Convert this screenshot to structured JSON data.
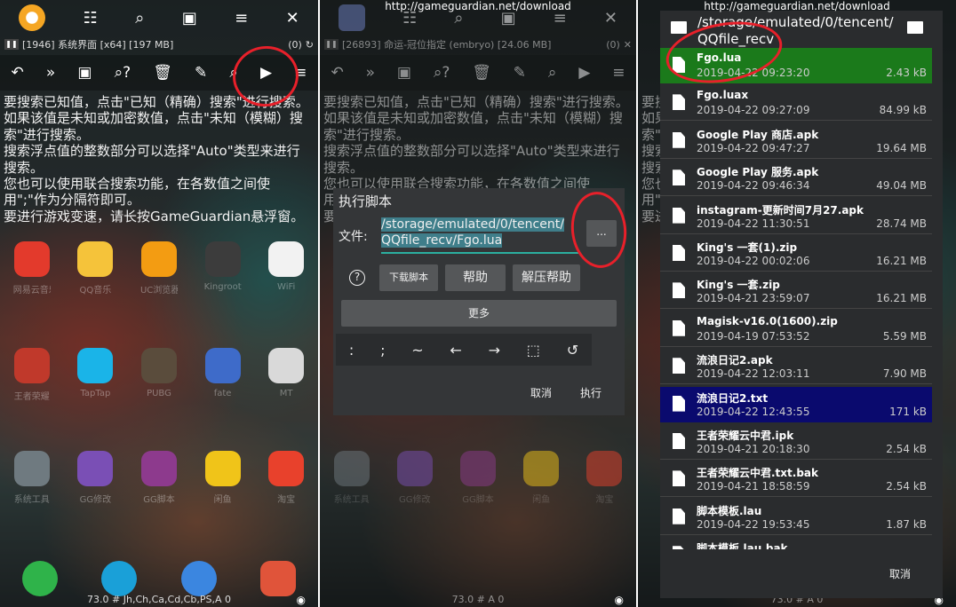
{
  "url": "http://gameguardian.net/download",
  "panel1": {
    "process": "[1946] 系统界面 [x64] [197 MB]",
    "found": "(0)",
    "help_lines": [
      "要搜索已知值，点击\"已知（精确）搜索\"进行搜索。",
      "如果该值是未知或加密数值，点击\"未知（模糊）搜",
      "索\"进行搜索。",
      "搜索浮点值的整数部分可以选择\"Auto\"类型来进行",
      "搜索。",
      "您也可以使用联合搜索功能，在各数值之间使",
      "用\";\"作为分隔符即可。",
      "要进行游戏变速，请长按GameGuardian悬浮窗。"
    ],
    "apps_row1": [
      "网易云音乐",
      "QQ音乐",
      "UC浏览器",
      "Kingroot",
      "WiFi"
    ],
    "apps_row2": [
      "王者荣耀",
      "TapTap",
      "PUBG",
      "fate",
      "MT"
    ],
    "apps_row3": [
      "系统工具",
      "GG修改",
      "GG脚本",
      "闲鱼",
      "淘宝"
    ],
    "bottom": "73.0 # Jh,Ch,Ca,Cd,Cb,PS,A 0"
  },
  "panel2": {
    "process": "[26893] 命运-冠位指定 (embryo) [24.06 MB]",
    "found": "(0)",
    "dialog_title": "执行脚本",
    "file_label": "文件:",
    "file_value_line1": "/storage/emulated/0/tencent/",
    "file_value_line2": "QQfile_recv/Fgo.lua",
    "browse_label": "...",
    "help_icon": "?",
    "download_label": "下载脚本",
    "help_label": "帮助",
    "unzip_help_label": "解压帮助",
    "more_label": "更多",
    "keys": [
      ":",
      ";",
      "~",
      "←",
      "→",
      "⬚",
      "↺"
    ],
    "cancel_label": "取消",
    "run_label": "执行",
    "bottom": "73.0 # A 0"
  },
  "panel3": {
    "path_line1": "/storage/emulated/0/tencent/",
    "path_line2": "QQfile_recv",
    "files": [
      {
        "name": "Fgo.lua",
        "date": "2019-04-22 09:23:20",
        "size": "2.43 kB",
        "highlight": "selected"
      },
      {
        "name": "Fgo.luax",
        "date": "2019-04-22 09:27:09",
        "size": "84.99 kB",
        "highlight": ""
      },
      {
        "name": "Google Play 商店.apk",
        "date": "2019-04-22 09:47:27",
        "size": "19.64 MB",
        "highlight": ""
      },
      {
        "name": "Google Play 服务.apk",
        "date": "2019-04-22 09:46:34",
        "size": "49.04 MB",
        "highlight": ""
      },
      {
        "name": "instagram-更新时间7月27.apk",
        "date": "2019-04-22 11:30:51",
        "size": "28.74 MB",
        "highlight": ""
      },
      {
        "name": "King's 一套(1).zip",
        "date": "2019-04-22 00:02:06",
        "size": "16.21 MB",
        "highlight": ""
      },
      {
        "name": "King's 一套.zip",
        "date": "2019-04-21 23:59:07",
        "size": "16.21 MB",
        "highlight": ""
      },
      {
        "name": "Magisk-v16.0(1600).zip",
        "date": "2019-04-19 07:53:52",
        "size": "5.59 MB",
        "highlight": ""
      },
      {
        "name": "流浪日记2.apk",
        "date": "2019-04-22 12:03:11",
        "size": "7.90 MB",
        "highlight": ""
      },
      {
        "name": "流浪日记2.txt",
        "date": "2019-04-22 12:43:55",
        "size": "171 kB",
        "highlight": "recent"
      },
      {
        "name": "王者荣耀云中君.ipk",
        "date": "2019-04-21 20:18:30",
        "size": "2.54 kB",
        "highlight": ""
      },
      {
        "name": "王者荣耀云中君.txt.bak",
        "date": "2019-04-21 18:58:59",
        "size": "2.54 kB",
        "highlight": ""
      },
      {
        "name": "脚本模板.lau",
        "date": "2019-04-22 19:53:45",
        "size": "1.87 kB",
        "highlight": ""
      },
      {
        "name": "脚本模板.lau.bak",
        "date": "",
        "size": "",
        "highlight": ""
      }
    ],
    "cancel_label": "取消",
    "bottom": "73.0 # A 0"
  },
  "colors": {
    "selected": "#1b7a1b",
    "recent": "#0a0a6e",
    "annotation": "#e8202a"
  }
}
